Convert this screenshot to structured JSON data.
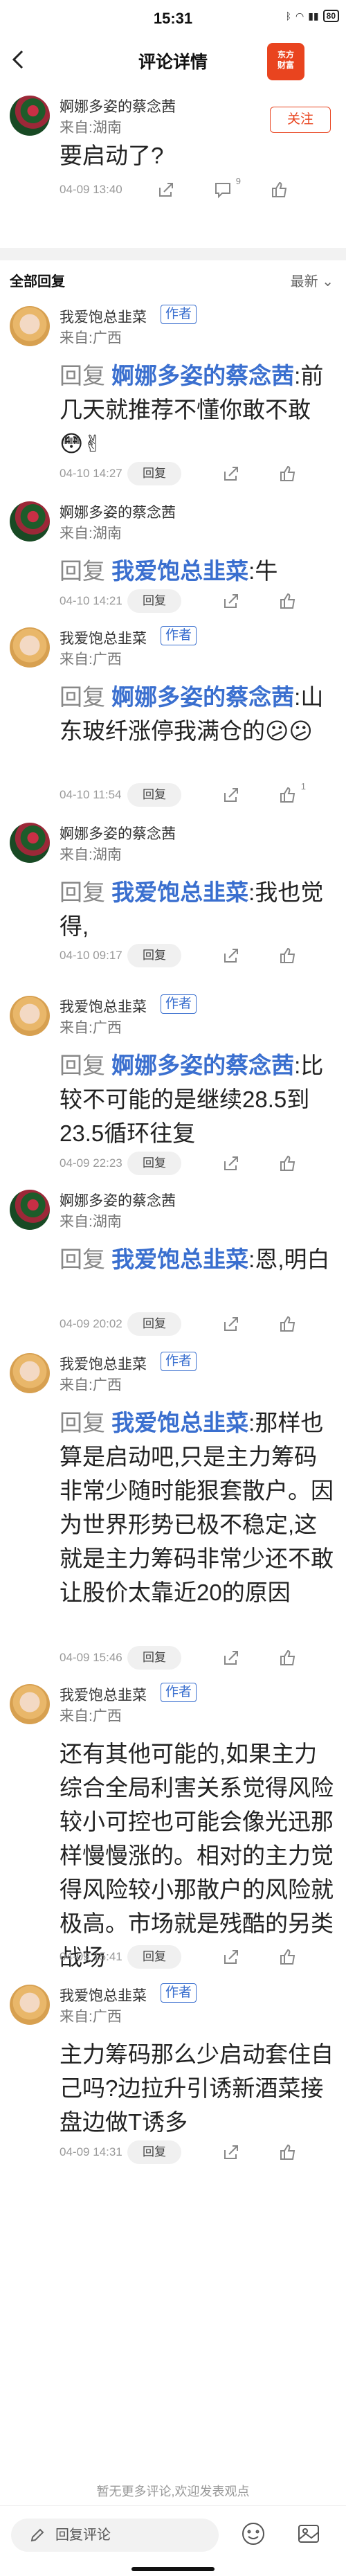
{
  "status": {
    "time": "15:31",
    "battery": "80"
  },
  "nav": {
    "title": "评论详情",
    "logo_line1": "东方",
    "logo_line2": "财富"
  },
  "head": {
    "name": "婀娜多姿的蔡念茜",
    "loc": "来自:湖南",
    "text": "要启动了?",
    "time": "04-09 13:40",
    "reply_count": "9",
    "follow": "关注"
  },
  "section": {
    "title": "全部回复",
    "sort": "最新"
  },
  "ui": {
    "reply_word": "回复",
    "reply_btn": "回复",
    "author_tag": "作者"
  },
  "replies": [
    {
      "name": "我爱饱总韭菜",
      "author": true,
      "loc": "来自:广西",
      "to": "婀娜多姿的蔡念茜",
      "text": ":前几天就推荐不懂你敢不敢😳✌",
      "time": "04-10 14:27",
      "likes": ""
    },
    {
      "name": "婀娜多姿的蔡念茜",
      "author": false,
      "loc": "来自:湖南",
      "to": "我爱饱总韭菜",
      "text": ":牛",
      "time": "04-10 14:21",
      "likes": ""
    },
    {
      "name": "我爱饱总韭菜",
      "author": true,
      "loc": "来自:广西",
      "to": "婀娜多姿的蔡念茜",
      "text": ":山东玻纤涨停我满仓的😕😕",
      "time": "04-10 11:54",
      "likes": "1"
    },
    {
      "name": "婀娜多姿的蔡念茜",
      "author": false,
      "loc": "来自:湖南",
      "to": "我爱饱总韭菜",
      "text": ":我也觉得,",
      "time": "04-10 09:17",
      "likes": ""
    },
    {
      "name": "我爱饱总韭菜",
      "author": true,
      "loc": "来自:广西",
      "to": "婀娜多姿的蔡念茜",
      "text": ":比较不可能的是继续28.5到23.5循环往复",
      "time": "04-09 22:23",
      "likes": ""
    },
    {
      "name": "婀娜多姿的蔡念茜",
      "author": false,
      "loc": "来自:湖南",
      "to": "我爱饱总韭菜",
      "text": ":恩,明白",
      "time": "04-09 20:02",
      "likes": ""
    },
    {
      "name": "我爱饱总韭菜",
      "author": true,
      "loc": "来自:广西",
      "to": "我爱饱总韭菜",
      "text": ":那样也算是启动吧,只是主力筹码非常少随时能狠套散户。因为世界形势已极不稳定,这就是主力筹码非常少还不敢让股价太靠近20的原因",
      "time": "04-09 15:46",
      "likes": ""
    },
    {
      "name": "我爱饱总韭菜",
      "author": true,
      "loc": "来自:广西",
      "to": "",
      "text": "还有其他可能的,如果主力综合全局利害关系觉得风险较小可控也可能会像光迅那样慢慢涨的。相对的主力觉得风险较小那散户的风险就极高。市场就是残酷的另类战场",
      "time": "04-09 15:41",
      "likes": ""
    },
    {
      "name": "我爱饱总韭菜",
      "author": true,
      "loc": "来自:广西",
      "to": "",
      "text": "主力筹码那么少启动套住自己吗?边拉升引诱新酒菜接盘边做T诱多",
      "time": "04-09 14:31",
      "likes": ""
    }
  ],
  "footer": {
    "note": "暂无更多评论,欢迎发表观点",
    "input_placeholder": "回复评论"
  }
}
